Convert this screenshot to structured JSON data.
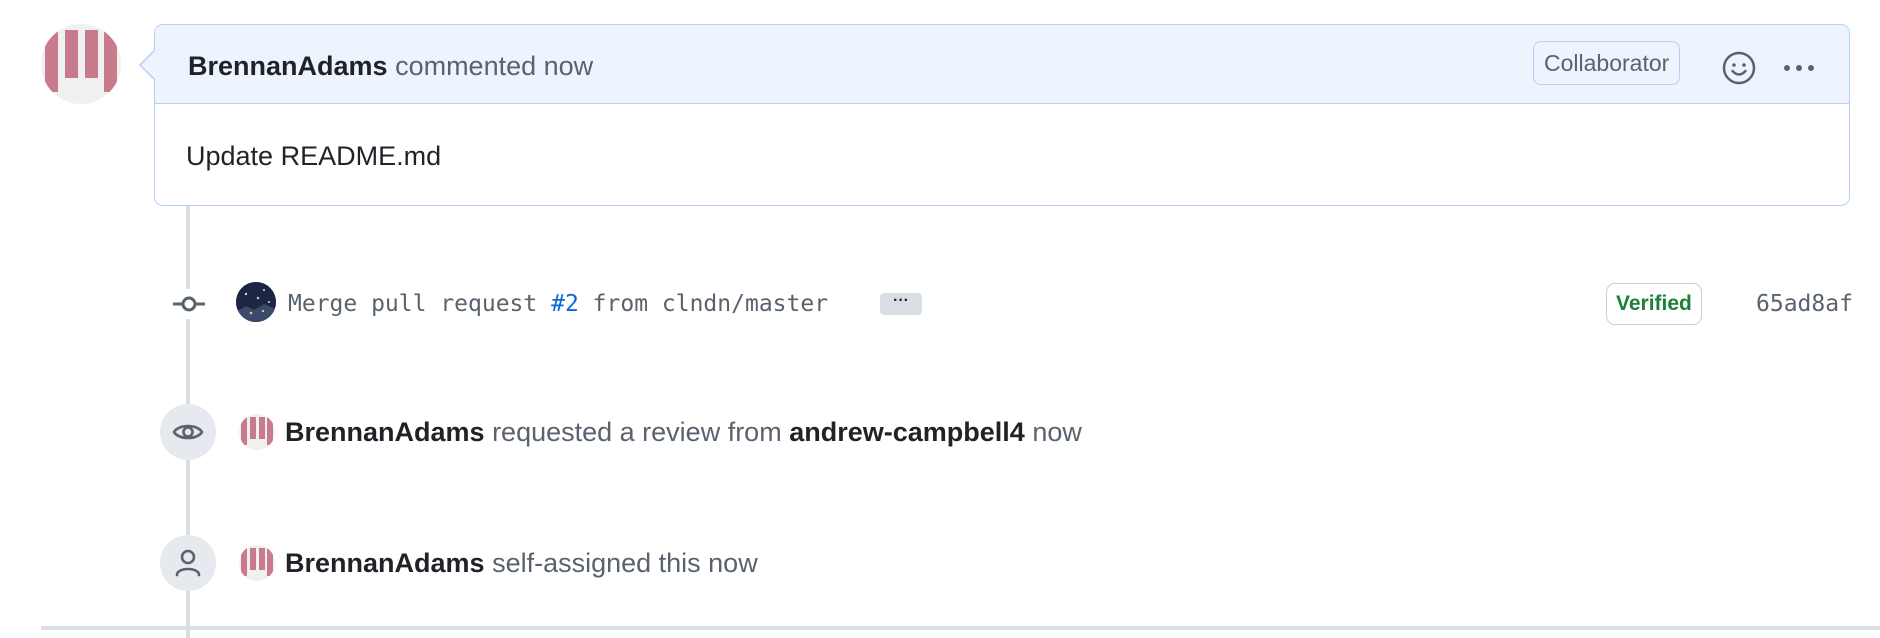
{
  "comment": {
    "author": "BrennanAdams",
    "action": "commented now",
    "role_badge": "Collaborator",
    "body": "Update README.md",
    "icons": {
      "reaction": "smiley-icon",
      "more": "kebab-horizontal-icon"
    }
  },
  "commit": {
    "msg_prefix": "Merge pull request ",
    "pr_ref": "#2",
    "msg_suffix": " from clndn/master",
    "expand_label": "···",
    "verified_label": "Verified",
    "sha": "65ad8af",
    "icons": {
      "commit": "git-commit-icon"
    }
  },
  "events": [
    {
      "icon": "eye-icon",
      "actor": "BrennanAdams",
      "text_mid": "requested a review from",
      "target": "andrew-campbell4",
      "time": "now"
    },
    {
      "icon": "person-icon",
      "actor": "BrennanAdams",
      "text_mid": "self-assigned this now"
    }
  ],
  "colors": {
    "accent_link": "#0969da",
    "verified_green": "#1a7f37",
    "comment_border": "#b6cff5",
    "header_bg": "#eef4fd",
    "avatar_pink": "#c97b8e"
  }
}
